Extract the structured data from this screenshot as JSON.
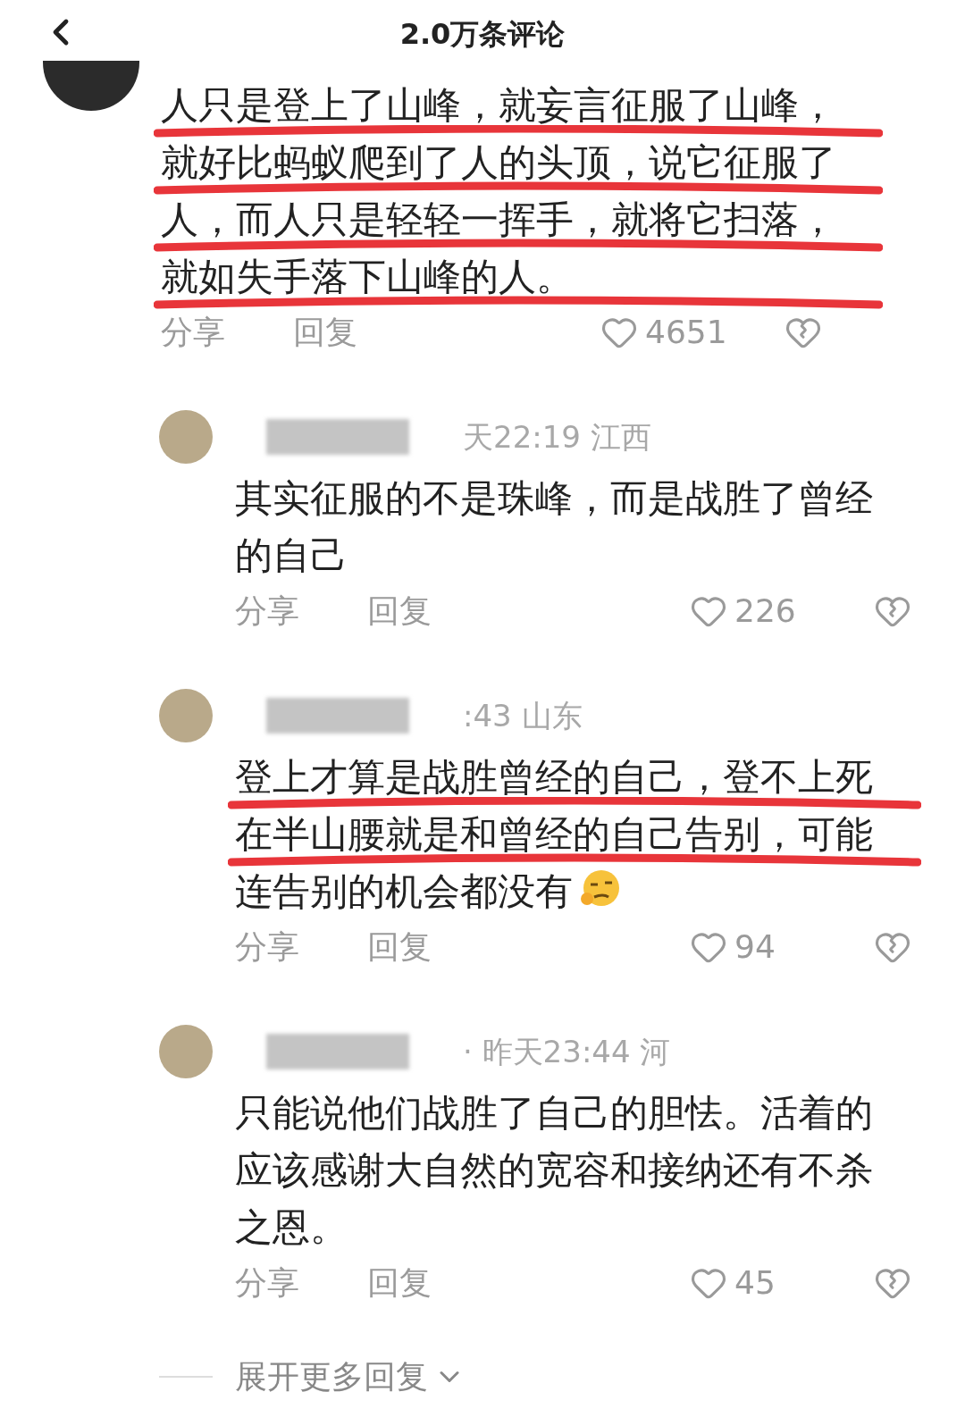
{
  "header": {
    "title": "2.0万条评论"
  },
  "comment": {
    "text": "人只是登上了山峰，就妄言征服了山峰，就好比蚂蚁爬到了人的头顶，说它征服了人，而人只是轻轻一挥手，就将它扫落，就如失手落下山峰的人。",
    "underlined": true,
    "share": "分享",
    "reply": "回复",
    "likes": "4651"
  },
  "replies": [
    {
      "meta": "天22:19 江西",
      "name_redacted": true,
      "text": "其实征服的不是珠峰，而是战胜了曾经的自己",
      "underlined": false,
      "emoji": false,
      "share": "分享",
      "reply": "回复",
      "likes": "226"
    },
    {
      "meta": ":43 山东",
      "name_redacted": true,
      "text": "登上才算是战胜曾经的自己，登不上死在半山腰就是和曾经的自己告别，可能连告别的机会都没有",
      "underlined": true,
      "emoji": true,
      "share": "分享",
      "reply": "回复",
      "likes": "94"
    },
    {
      "meta": "· 昨天23:44 河",
      "name_redacted": true,
      "text": "只能说他们战胜了自己的胆怯。活着的应该感谢大自然的宽容和接纳还有不杀之恩。",
      "underlined": false,
      "emoji": false,
      "share": "分享",
      "reply": "回复",
      "likes": "45"
    }
  ],
  "more": {
    "label": "展开更多回复"
  }
}
